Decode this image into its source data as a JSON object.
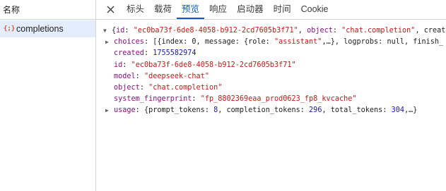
{
  "left_pane": {
    "header": "名称",
    "item": {
      "icon": "{;}",
      "label": "completions"
    }
  },
  "tabs": {
    "close_icon": "×",
    "items": [
      "标头",
      "载荷",
      "预览",
      "响应",
      "启动器",
      "时间",
      "Cookie"
    ],
    "active": "预览"
  },
  "preview": {
    "summary": {
      "open": "{",
      "id_key": "id",
      "id_val": "\"ec0ba73f-6de8-4058-b912-2cd7605b3f71\"",
      "object_key": "object",
      "object_val": "\"chat.completion\"",
      "tail": ", create"
    },
    "choices": {
      "key": "choices",
      "text_a": "[{index: 0, message: {role: ",
      "role_val": "\"assistant\"",
      "text_b": ",…}, logprobs: null, finish_"
    },
    "created": {
      "key": "created",
      "value": "1755582974"
    },
    "id": {
      "key": "id",
      "value": "\"ec0ba73f-6de8-4058-b912-2cd7605b3f71\""
    },
    "model": {
      "key": "model",
      "value": "\"deepseek-chat\""
    },
    "object": {
      "key": "object",
      "value": "\"chat.completion\""
    },
    "system_fingerprint": {
      "key": "system_fingerprint",
      "value": "\"fp_8802369eaa_prod0623_fp8_kvcache\""
    },
    "usage": {
      "key": "usage",
      "text_a": "{prompt_tokens: ",
      "prompt_tokens": "8",
      "text_b": ", completion_tokens: ",
      "completion_tokens": "296",
      "text_c": ", total_tokens: ",
      "total_tokens": "304",
      "text_d": ",…}"
    }
  },
  "colors": {
    "accent": "#0b57d0",
    "selected_row": "#e3edfb",
    "key": "#881280",
    "string": "#c41a16",
    "number": "#1a1aa6"
  }
}
